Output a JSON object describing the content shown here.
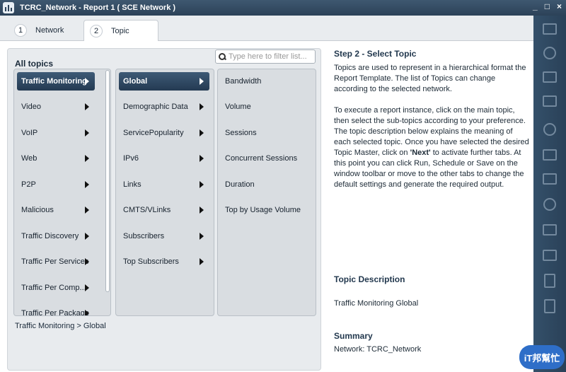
{
  "window": {
    "title": "TCRC_Network - Report 1 ( SCE Network )",
    "controls": [
      "_",
      "□",
      "×"
    ]
  },
  "tabs": [
    {
      "num": "1",
      "label": "Network"
    },
    {
      "num": "2",
      "label": "Topic"
    }
  ],
  "topics_panel": {
    "title": "All topics",
    "filter_placeholder": "Type here to filter list...",
    "col1": [
      "Traffic Monitoring",
      "Video",
      "VoIP",
      "Web",
      "P2P",
      "Malicious",
      "Traffic Discovery",
      "Traffic Per Services",
      "Traffic Per Comp...",
      "Traffic Per Package"
    ],
    "col2": [
      "Global",
      "Demographic Data",
      "ServicePopularity",
      "IPv6",
      "Links",
      "CMTS/VLinks",
      "Subscribers",
      "Top Subscribers"
    ],
    "col3": [
      "Bandwidth",
      "Volume",
      "Sessions",
      "Concurrent Sessions",
      "Duration",
      "Top by Usage Volume"
    ],
    "breadcrumb": "Traffic Monitoring > Global"
  },
  "info": {
    "step_title": "Step 2 - Select Topic",
    "para1": "Topics are used to represent in a hierarchical format the Report Template. The list of Topics can change according to the selected network.",
    "para2_a": "To execute a report instance, click on the main topic, then select the sub-topics according to your preference. The topic description below explains the meaning of each selected topic. Once you have selected the desired Topic Master, click on ",
    "para2_bold": "'Next'",
    "para2_b": " to activate further tabs. At this point you can click Run, Schedule or Save on the window toolbar or move to the other tabs to change the default settings and generate the required output.",
    "desc_title": "Topic Description",
    "desc_text": "Traffic Monitoring Global",
    "summary_title": "Summary",
    "summary_text": "Network: TCRC_Network"
  },
  "toolbar_icons": [
    "next-icon",
    "alarm-icon",
    "download-icon",
    "split-icon",
    "network-icon",
    "layout-icon",
    "upload-icon",
    "pin-icon",
    "mail-icon",
    "monitor-icon",
    "pdf-icon",
    "excel-icon"
  ],
  "watermark": "iT邦幫忙"
}
